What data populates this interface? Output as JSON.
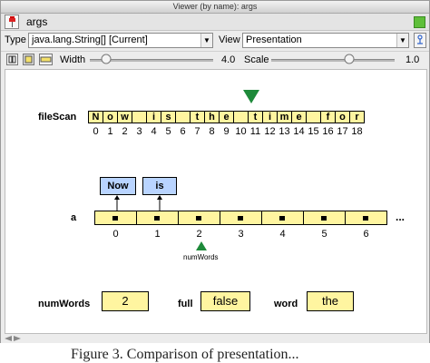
{
  "window": {
    "title": "Viewer (by name): args"
  },
  "header": {
    "variable": "args"
  },
  "toolbar": {
    "type_label": "Type",
    "type_value": "java.lang.String[]  [Current]",
    "view_label": "View",
    "view_value": "Presentation",
    "width_label": "Width",
    "width_value": "4.0",
    "scale_label": "Scale",
    "scale_value": "1.0"
  },
  "fileScan": {
    "label": "fileScan",
    "chars": [
      "N",
      "o",
      "w",
      " ",
      "i",
      "s",
      " ",
      "t",
      "h",
      "e",
      " ",
      "t",
      "i",
      "m",
      "e",
      " ",
      "f",
      "o",
      "r"
    ],
    "indices": [
      "0",
      "1",
      "2",
      "3",
      "4",
      "5",
      "6",
      "7",
      "8",
      "9",
      "10",
      "11",
      "12",
      "13",
      "14",
      "15",
      "16",
      "17",
      "18"
    ]
  },
  "array": {
    "label": "a",
    "indices": [
      "0",
      "1",
      "2",
      "3",
      "4",
      "5",
      "6"
    ],
    "ellipsis": "...",
    "strings": [
      "Now",
      "is"
    ],
    "pointer_label": "numWords"
  },
  "fields": {
    "numWords_label": "numWords",
    "numWords_value": "2",
    "full_label": "full",
    "full_value": "false",
    "word_label": "word",
    "word_value": "the"
  },
  "caption": "Figure 3. Comparison of presentation..."
}
